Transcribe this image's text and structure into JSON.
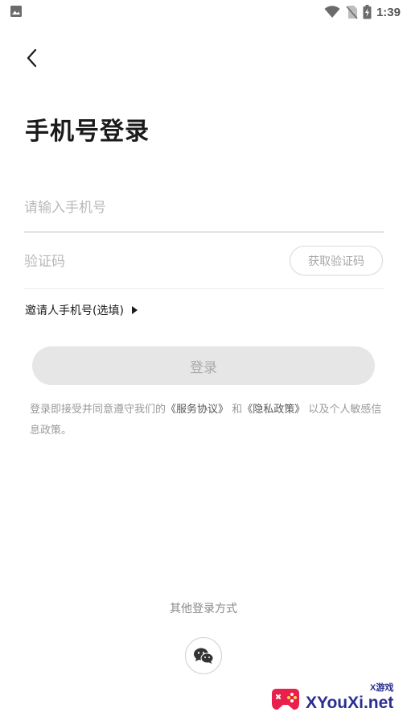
{
  "status_bar": {
    "time": "1:39",
    "left_icon": "image-icon",
    "right_icons": [
      "wifi-icon",
      "no-sim-icon",
      "battery-charging-icon"
    ]
  },
  "header": {
    "back_icon": "chevron-left-icon",
    "title": "手机号登录"
  },
  "form": {
    "phone_placeholder": "请输入手机号",
    "phone_value": "",
    "code_placeholder": "验证码",
    "code_value": "",
    "get_code_label": "获取验证码",
    "invite_label": "邀请人手机号(选填)",
    "login_label": "登录"
  },
  "agreement": {
    "prefix": "登录即接受并同意遵守我们的",
    "service_link": "《服务协议》",
    "and": "和",
    "privacy_link": "《隐私政策》",
    "suffix": "以及个人敏感信息政策。"
  },
  "other_login": {
    "label": "其他登录方式",
    "wechat_icon": "wechat-icon"
  },
  "watermark": {
    "text": "XYouXi.net",
    "sub": "X游戏"
  },
  "colors": {
    "login_button_bg": "#e6e6e6",
    "disabled_text": "#a9a9a9",
    "placeholder": "#b9b9b9",
    "watermark_blue": "#2a2f8f",
    "watermark_red": "#e8204b"
  }
}
